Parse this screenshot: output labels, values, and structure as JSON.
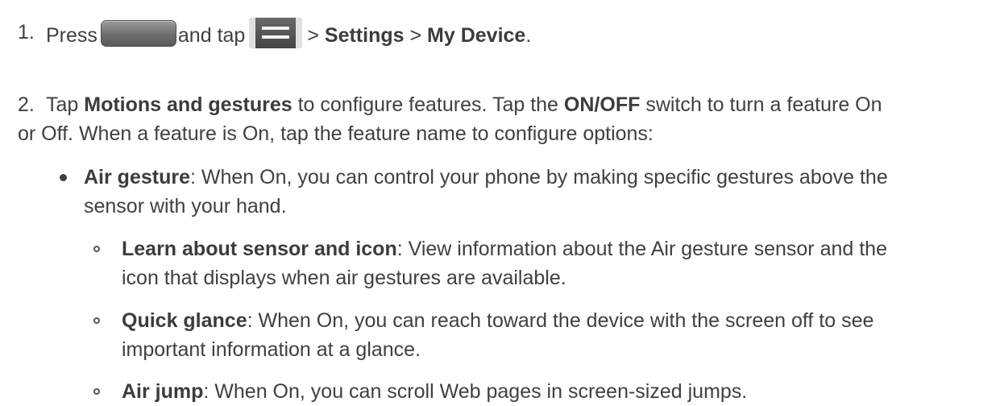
{
  "step1": {
    "number": "1.",
    "press": "Press",
    "and_tap": "and tap",
    "sep1": ">",
    "settings": "Settings",
    "sep2": ">",
    "my_device": "My Device",
    "end": "."
  },
  "step2": {
    "number": "2.",
    "tap": "Tap",
    "motions": "Motions and gestures",
    "mid": "to configure features. Tap the",
    "onoff": "ON/OFF",
    "tail": "switch to turn a feature On",
    "line2": "or Off. When a feature is On, tap the feature name to configure options:"
  },
  "air_gesture": {
    "title": "Air gesture",
    "text1": ": When On, you can control your phone by making specific gestures above the",
    "text2": "sensor with your hand."
  },
  "learn": {
    "title": "Learn about sensor and icon",
    "text1": ": View information about the Air gesture sensor and the",
    "text2": "icon that displays when air gestures are available."
  },
  "quick": {
    "title": "Quick glance",
    "text1": ": When On, you can reach toward the device with the screen off to see",
    "text2": "important information at a glance."
  },
  "airjump": {
    "title": "Air jump",
    "text1": ": When On, you can scroll Web pages in screen-sized jumps."
  },
  "icons": {
    "home": "home-key-icon",
    "menu": "menu-key-icon"
  }
}
